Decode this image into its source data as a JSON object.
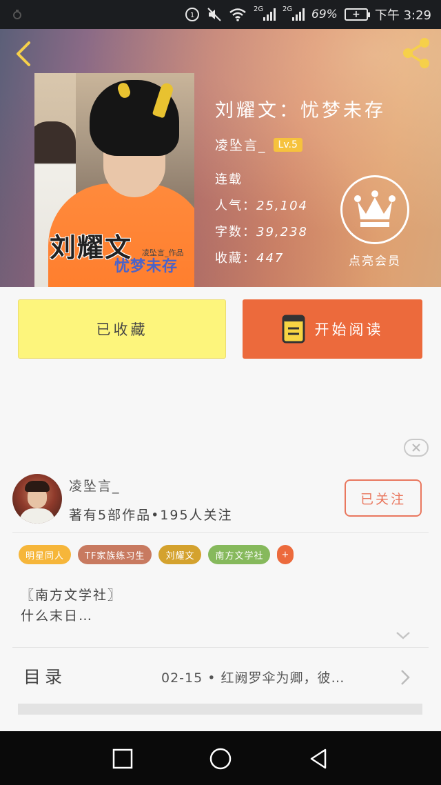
{
  "status_bar": {
    "network_1": "2G",
    "network_2": "2G",
    "battery_percent": "69%",
    "time": "下午 3:29"
  },
  "book": {
    "cover_title": "刘耀文",
    "cover_subtitle": "忧梦未存",
    "cover_credit": "凌坠言_作品",
    "title": "刘耀文：忧梦未存",
    "author": "凌坠言_",
    "level": "Lv.5",
    "status": "连载",
    "popularity_label": "人气：",
    "popularity": "25,104",
    "words_label": "字数：",
    "words": "39,238",
    "favorites_label": "收藏：",
    "favorites": "447",
    "vip_label": "点亮会员"
  },
  "actions": {
    "collected_label": "已收藏",
    "read_label": "开始阅读"
  },
  "author_card": {
    "name": "凌坠言_",
    "stats": "著有5部作品•195人关注",
    "follow_label": "已关注"
  },
  "tags": [
    {
      "label": "明星同人",
      "color": "#f6b63a"
    },
    {
      "label": "TF家族练习生",
      "color": "#c87a60"
    },
    {
      "label": "刘耀文",
      "color": "#d4a22e"
    },
    {
      "label": "南方文学社",
      "color": "#86b95c"
    },
    {
      "label": "+",
      "color": "#ec6a3c"
    }
  ],
  "description": {
    "line1": "〖南方文学社〗",
    "line2": "什么末日…"
  },
  "toc": {
    "label": "目录",
    "latest": "02-15 • 红阙罗伞为卿，彼…"
  },
  "colors": {
    "accent_orange": "#ec6a3c",
    "collected_yellow": "#fdf57c",
    "follow_red": "#e9775e",
    "lv_badge": "#f6c23d"
  }
}
